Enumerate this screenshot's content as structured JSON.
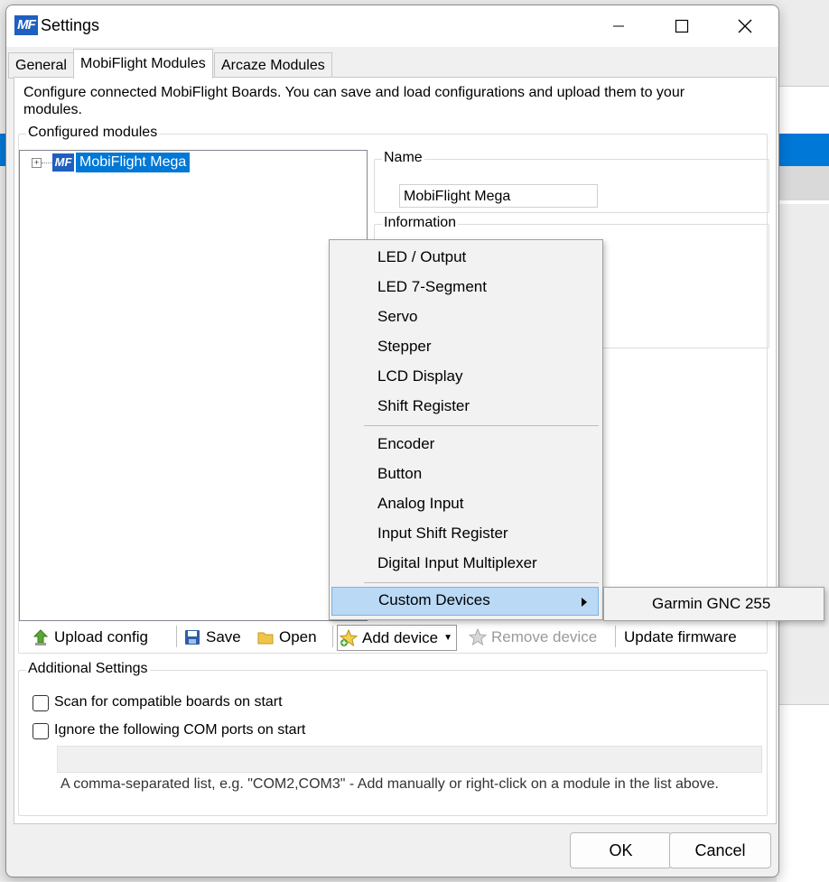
{
  "window": {
    "title": "Settings",
    "logo_text": "MF"
  },
  "tabs": [
    {
      "label": "General"
    },
    {
      "label": "MobiFlight Modules"
    },
    {
      "label": "Arcaze Modules"
    }
  ],
  "description": "Configure connected MobiFlight Boards. You can save and load configurations and upload them to your modules.",
  "configured_modules": {
    "label": "Configured modules",
    "tree_item": {
      "icon_text": "MF",
      "label": "MobiFlight Mega",
      "expander": "+"
    }
  },
  "name_group": {
    "label": "Name",
    "value": "MobiFlight Mega"
  },
  "information_group": {
    "label": "Information"
  },
  "toolbar": {
    "upload_config": "Upload config",
    "save": "Save",
    "open": "Open",
    "add_device": "Add device",
    "remove_device": "Remove device",
    "update_firmware": "Update firmware"
  },
  "context_menu": {
    "items": [
      "LED / Output",
      "LED 7-Segment",
      "Servo",
      "Stepper",
      "LCD Display",
      "Shift Register",
      "Encoder",
      "Button",
      "Analog Input",
      "Input Shift Register",
      "Digital Input Multiplexer",
      "Custom Devices"
    ],
    "submenu_item": "Garmin GNC 255"
  },
  "additional_settings": {
    "label": "Additional Settings",
    "scan_label": "Scan for compatible boards on start",
    "scan_checked": false,
    "ignore_label": "Ignore the following COM ports on start",
    "ignore_checked": false,
    "com_ports_value": "",
    "hint": "A comma-separated list, e.g. \"COM2,COM3\" - Add manually or right-click on a module in the list above."
  },
  "buttons": {
    "ok": "OK",
    "cancel": "Cancel"
  },
  "colors": {
    "selection": "#0078d7",
    "menu_highlight": "#b9d9f5",
    "logo": "#1f5fbf"
  }
}
